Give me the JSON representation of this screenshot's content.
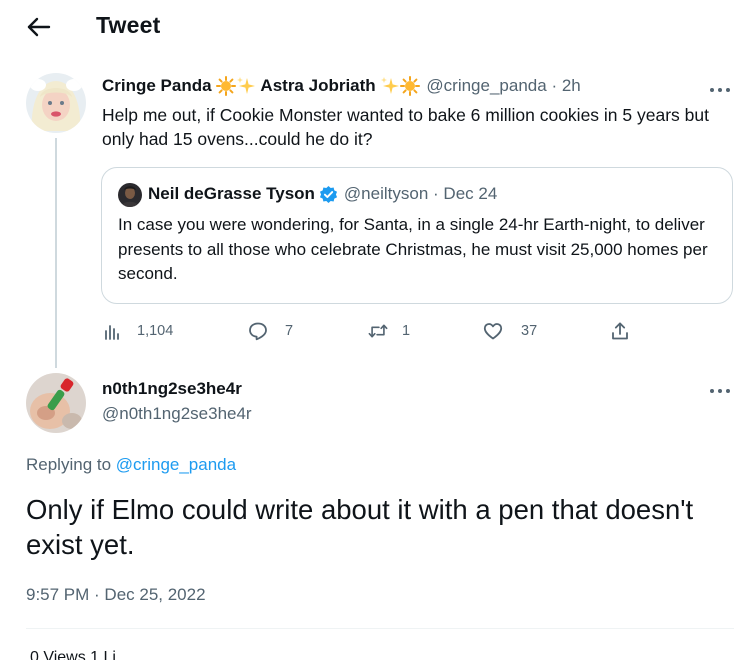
{
  "header": {
    "title": "Tweet",
    "back_icon": "arrow-left-icon"
  },
  "parent_tweet": {
    "name_part1": "Cringe Panda",
    "name_part2": "Astra Jobriath",
    "name_emojis": [
      "sun-emoji",
      "sparkles-emoji",
      "sparkles-emoji",
      "sun-emoji"
    ],
    "handle": "@cringe_panda",
    "separator": "·",
    "time": "2h",
    "text": "Help me out, if Cookie Monster wanted to bake 6 million cookies in 5 years but only had 15 ovens...could he do it?",
    "quote": {
      "name": "Neil deGrasse Tyson",
      "handle": "@neiltyson",
      "separator": "·",
      "date": "Dec 24",
      "text": "In case you were wondering, for Santa, in a single 24-hr Earth-night, to deliver presents to all those who celebrate Christmas, he must visit 25,000 homes per second."
    },
    "actions": {
      "views": "1,104",
      "replies": "7",
      "retweets": "1",
      "likes": "37"
    }
  },
  "reply": {
    "name": "n0th1ng2se3he4r",
    "handle": "@n0th1ng2se3he4r",
    "replying_prefix": "Replying to",
    "replying_handle": "@cringe_panda",
    "text": "Only if Elmo could write about it with a pen that doesn't exist yet.",
    "time": "9:57 PM · Dec 25, 2022",
    "stats_partial": "0 Views   1 Li"
  },
  "colors": {
    "text": "#0f1419",
    "secondary": "#536471",
    "link": "#1d9bf0",
    "border": "#cfd9de",
    "verified": "#1d9bf0"
  }
}
